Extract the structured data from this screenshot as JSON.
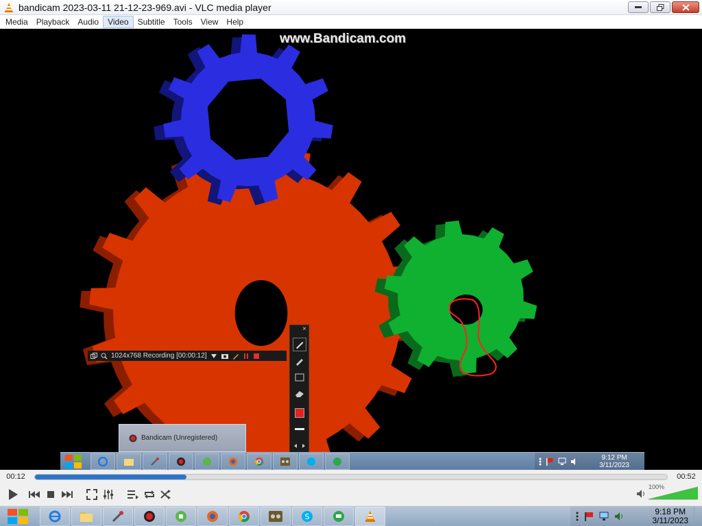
{
  "window": {
    "title": "bandicam 2023-03-11 21-12-23-969.avi - VLC media player"
  },
  "menu": {
    "items": [
      "Media",
      "Playback",
      "Audio",
      "Video",
      "Subtitle",
      "Tools",
      "View",
      "Help"
    ],
    "hover_index": 3
  },
  "video": {
    "watermark": "www.Bandicam.com",
    "gear_colors": {
      "blue": "#2a2ee0",
      "red": "#d83400",
      "green": "#10b030"
    },
    "bandicam_bar": {
      "text": "1024x768  Recording  [00:00:12]"
    },
    "bandicam_tooltip": "Bandicam (Unregistered)",
    "inner_taskbar": {
      "clock_time": "9:12 PM",
      "clock_date": "3/11/2023"
    }
  },
  "player": {
    "elapsed": "00:12",
    "duration": "00:52",
    "progress": 0.24,
    "volume_label": "100%",
    "volume": 1.0
  },
  "taskbar": {
    "clock_time": "9:18 PM",
    "clock_date": "3/11/2023",
    "apps": [
      "internet-explorer",
      "file-explorer",
      "tools",
      "bandicam",
      "app-green",
      "firefox",
      "chrome",
      "media-app",
      "skype",
      "app-talk",
      "vlc"
    ],
    "active_app": "vlc"
  }
}
